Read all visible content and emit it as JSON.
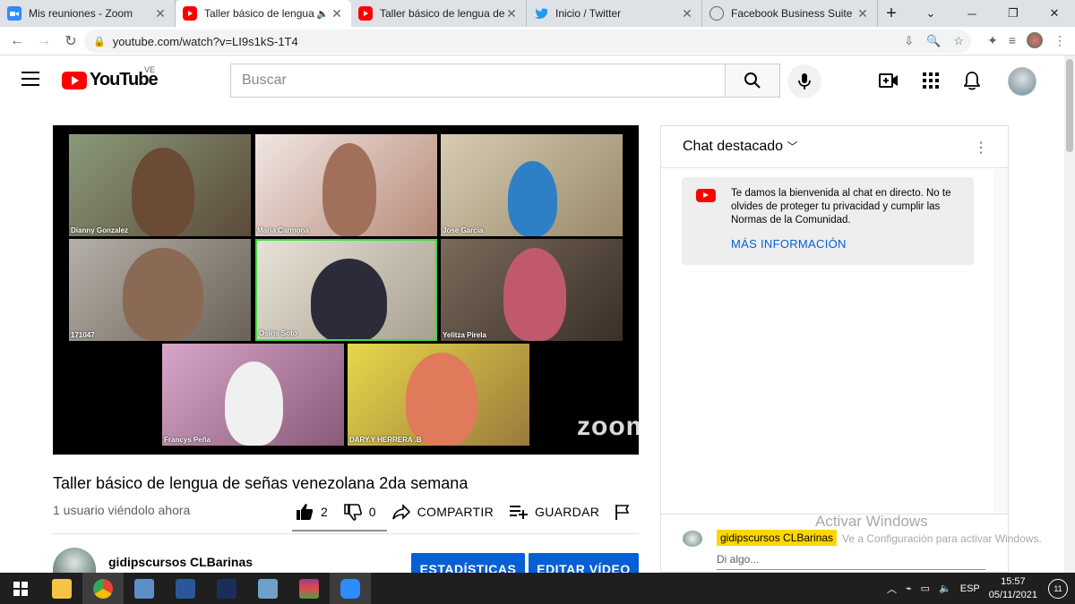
{
  "browser": {
    "tabs": [
      {
        "title": "Mis reuniones - Zoom",
        "icon": "zoom-icon",
        "active": false
      },
      {
        "title": "Taller básico de lengua de",
        "icon": "youtube-icon",
        "active": true
      },
      {
        "title": "Taller básico de lengua de señ",
        "icon": "youtube-icon",
        "active": false
      },
      {
        "title": "Inicio / Twitter",
        "icon": "twitter-icon",
        "active": false
      },
      {
        "title": "Facebook Business Suite",
        "icon": "facebook-icon",
        "active": false
      }
    ],
    "new_tab": "+",
    "url": "youtube.com/watch?v=LI9s1kS-1T4"
  },
  "youtube": {
    "logo_text": "YouTube",
    "country_code": "VE",
    "search_placeholder": "Buscar"
  },
  "video": {
    "participants": [
      {
        "name": "Dianny Gonzalez"
      },
      {
        "name": "Maria Carmona"
      },
      {
        "name": "Jose Garcia"
      },
      {
        "name": "171047"
      },
      {
        "name": "Osiris Soto"
      },
      {
        "name": "Yelitza Pirela"
      },
      {
        "name": "Francys Peña"
      },
      {
        "name": "DARY.Y HERRERA .B"
      }
    ],
    "watermark": "zoom",
    "title": "Taller básico de lengua de señas venezolana 2da semana",
    "views": "1 usuario viéndolo ahora",
    "likes": "2",
    "dislikes": "0",
    "share_label": "COMPARTIR",
    "save_label": "GUARDAR"
  },
  "channel": {
    "name": "gidipscursos CLBarinas",
    "stats_button": "ESTADÍSTICAS",
    "edit_button": "EDITAR VÍDEO"
  },
  "chat": {
    "header": "Chat destacado",
    "welcome": "Te damos la bienvenida al chat en directo. No te olvides de proteger tu privacidad y cumplir las Normas de la Comunidad.",
    "more_info": "MÁS INFORMACIÓN",
    "user": "gidipscursos CLBarinas",
    "input_placeholder": "Di algo..."
  },
  "windows": {
    "activate_title": "Activar Windows",
    "activate_sub": "Ve a Configuración para activar Windows.",
    "lang": "ESP",
    "time": "15:57",
    "date": "05/11/2021",
    "notifications": "11"
  },
  "colors": {
    "youtube_red": "#ff0000",
    "link_blue": "#065fd4",
    "zoom_active_border": "#3ddc3d"
  }
}
